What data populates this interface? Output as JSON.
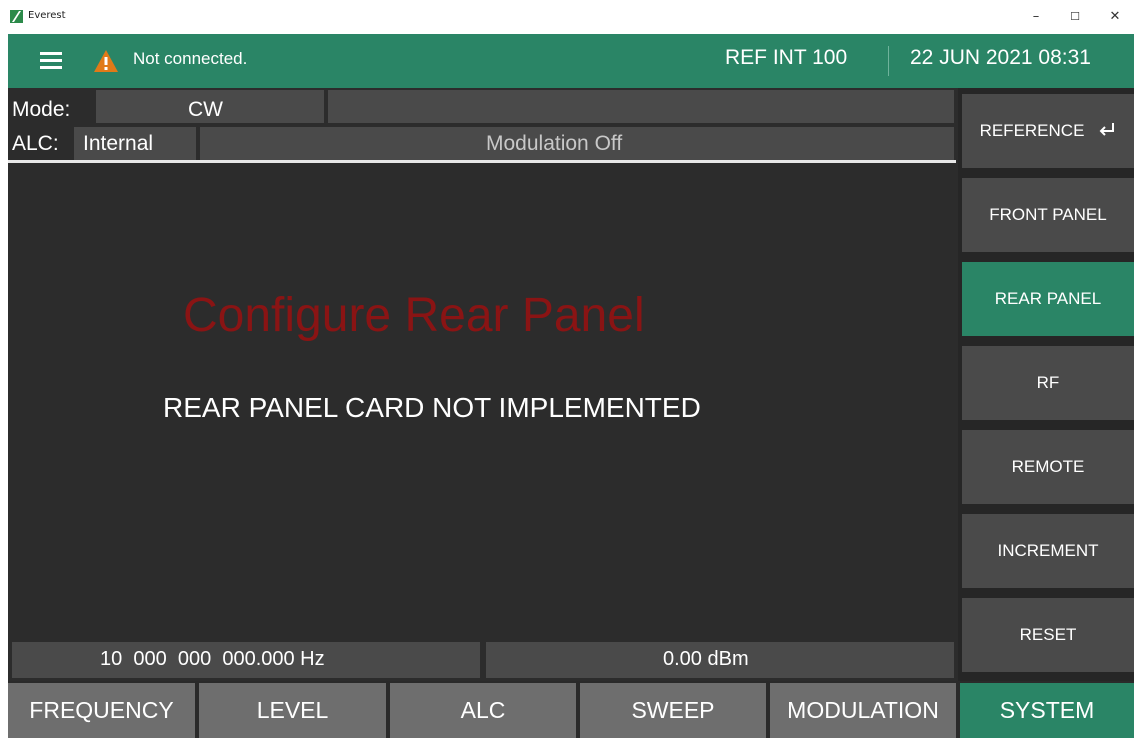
{
  "window": {
    "title": "Everest",
    "minimize_glyph": "–",
    "maximize_glyph": "☐",
    "close_glyph": "✕"
  },
  "header": {
    "status_text": "Not connected.",
    "reference": "REF INT 100",
    "datetime": "22 JUN 2021 08:31",
    "accent_color": "#2a8566",
    "warning_color": "#e07a18"
  },
  "main": {
    "mode_label": "Mode:",
    "mode_value": "CW",
    "alc_label": "ALC:",
    "alc_value": "Internal",
    "modulation_status": "Modulation Off",
    "title": "Configure Rear Panel",
    "message": "REAR PANEL CARD NOT IMPLEMENTED",
    "frequency_readout": "10  000  000  000.000 Hz",
    "level_readout": "0.00 dBm"
  },
  "sidebar": {
    "items": [
      {
        "label": "REFERENCE",
        "icon": "enter-return-icon",
        "active": false
      },
      {
        "label": "FRONT PANEL",
        "active": false
      },
      {
        "label": "REAR PANEL",
        "active": true
      },
      {
        "label": "RF",
        "active": false
      },
      {
        "label": "REMOTE",
        "active": false
      },
      {
        "label": "INCREMENT",
        "active": false
      },
      {
        "label": "RESET",
        "active": false
      }
    ]
  },
  "tabs": [
    {
      "label": "FREQUENCY",
      "active": false
    },
    {
      "label": "LEVEL",
      "active": false
    },
    {
      "label": "ALC",
      "active": false
    },
    {
      "label": "SWEEP",
      "active": false
    },
    {
      "label": "MODULATION",
      "active": false
    },
    {
      "label": "SYSTEM",
      "active": true
    }
  ]
}
